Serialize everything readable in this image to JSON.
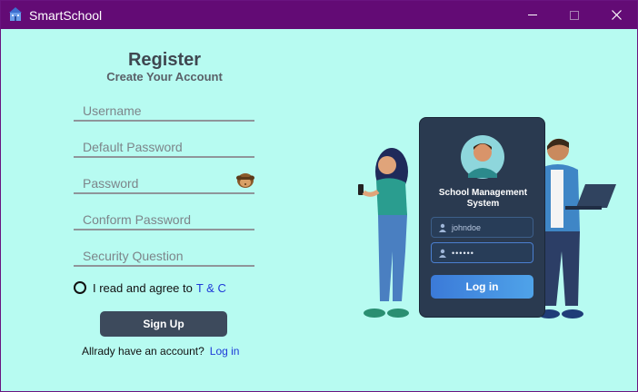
{
  "window": {
    "title": "SmartSchool",
    "controls": [
      "minimize-icon",
      "maximize-icon",
      "close-icon"
    ],
    "title_bar_color": "#630b75",
    "background_color": "#b7fbf1"
  },
  "form": {
    "title": "Register",
    "subtitle": "Create Your Account",
    "fields": {
      "username": {
        "placeholder": "Username",
        "value": ""
      },
      "default_password": {
        "placeholder": "Default Password",
        "value": ""
      },
      "password": {
        "placeholder": "Password",
        "value": ""
      },
      "confirm_password": {
        "placeholder": "Conform Password",
        "value": ""
      },
      "security_question": {
        "placeholder": "Security Question",
        "value": ""
      }
    },
    "password_toggle_icon": "monkey-eye-icon",
    "agree_text": "I read and agree to",
    "tc_link": "T & C",
    "signup_label": "Sign Up",
    "account_text": "Allrady have an account?",
    "login_link": "Log in",
    "accent_color": "#1e3ad8",
    "button_color": "#3d4a5c"
  },
  "illustration": {
    "card_title_line1": "School Management",
    "card_title_line2": "System",
    "username_value": "johndoe",
    "password_value": "••••••",
    "login_label": "Log in",
    "card_color": "#2a3a50"
  }
}
